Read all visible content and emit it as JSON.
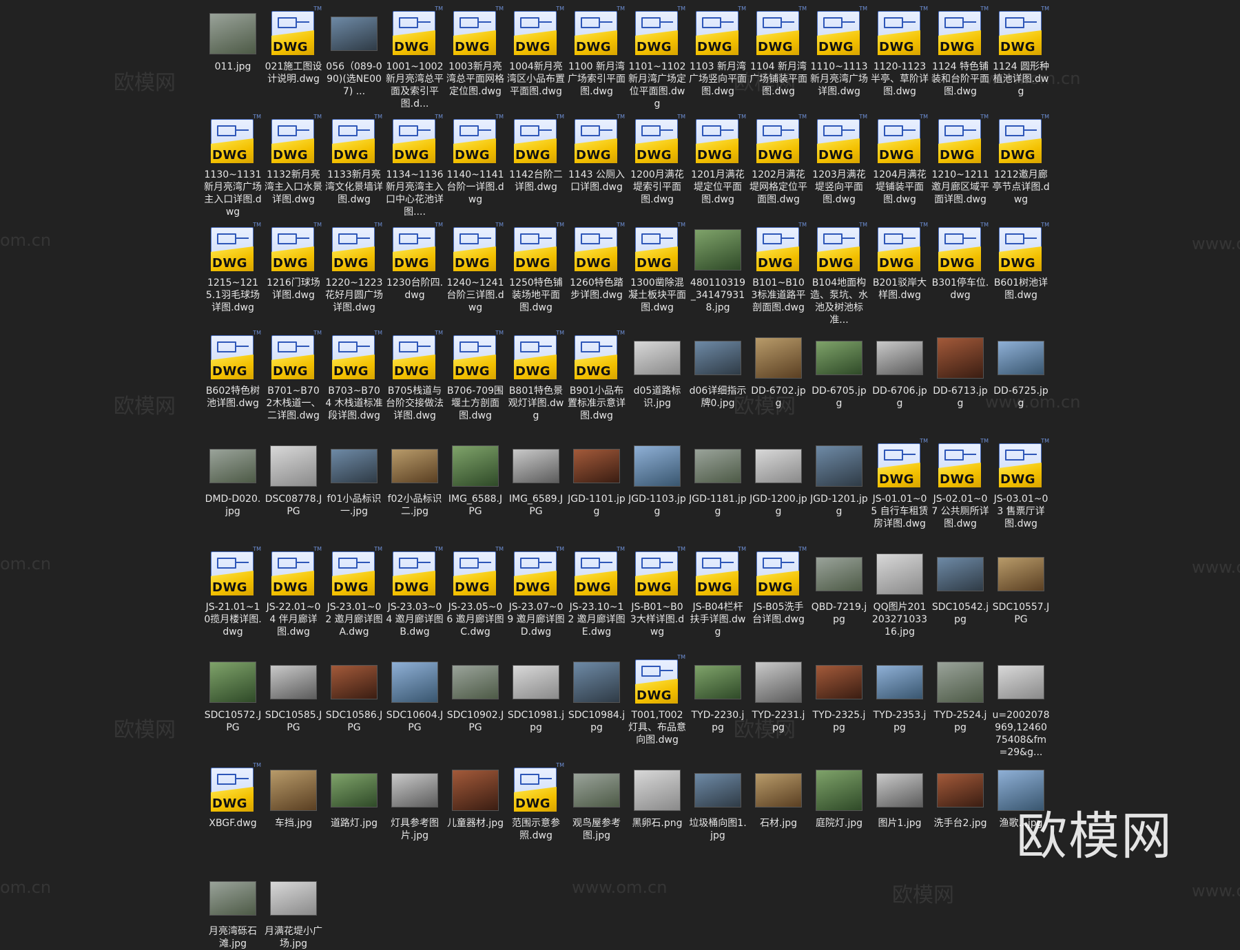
{
  "colors": {
    "background": "#222222",
    "label": "#e6e6e6"
  },
  "watermark": {
    "text_cn": "欧模网",
    "text_url": "www.om.cn",
    "text_partial": "om.cn",
    "corner": "欧模网"
  },
  "files": [
    {
      "name": "011.jpg",
      "kind": "img"
    },
    {
      "name": "021施工图设计说明.dwg",
      "kind": "dwg"
    },
    {
      "name": "056（089-090)(选NE007) ...",
      "kind": "img"
    },
    {
      "name": "1001~1002新月亮湾总平面及索引平图.d...",
      "kind": "dwg"
    },
    {
      "name": "1003新月亮湾总平面网格定位图.dwg",
      "kind": "dwg"
    },
    {
      "name": "1004新月亮湾区小品布置平面图.dwg",
      "kind": "dwg"
    },
    {
      "name": "1100 新月湾广场索引平面图.dwg",
      "kind": "dwg"
    },
    {
      "name": "1101~1102 新月湾广场定位平面图.dwg",
      "kind": "dwg"
    },
    {
      "name": "1103 新月湾广场竖向平面图.dwg",
      "kind": "dwg"
    },
    {
      "name": "1104 新月湾广场铺装平面图.dwg",
      "kind": "dwg"
    },
    {
      "name": "1110~1113新月亮湾广场详图.dwg",
      "kind": "dwg"
    },
    {
      "name": "1120-1123 半亭、草阶详图.dwg",
      "kind": "dwg"
    },
    {
      "name": "1124 特色铺装和台阶平面图.dwg",
      "kind": "dwg"
    },
    {
      "name": "1124 圆形种植池详图.dwg",
      "kind": "dwg"
    },
    {
      "name": "1130~1131新月亮湾广场主入口详图.dwg",
      "kind": "dwg"
    },
    {
      "name": "1132新月亮湾主入口水景详图.dwg",
      "kind": "dwg"
    },
    {
      "name": "1133新月亮湾文化景墙详图.dwg",
      "kind": "dwg"
    },
    {
      "name": "1134~1136新月亮湾主入口中心花池详图....",
      "kind": "dwg"
    },
    {
      "name": "1140~1141台阶一详图.dwg",
      "kind": "dwg"
    },
    {
      "name": "1142台阶二详图.dwg",
      "kind": "dwg"
    },
    {
      "name": "1143 公厕入口详图.dwg",
      "kind": "dwg"
    },
    {
      "name": "1200月满花堤索引平面图.dwg",
      "kind": "dwg"
    },
    {
      "name": "1201月满花堤定位平面图.dwg",
      "kind": "dwg"
    },
    {
      "name": "1202月满花堤网格定位平面图.dwg",
      "kind": "dwg"
    },
    {
      "name": "1203月满花堤竖向平面图.dwg",
      "kind": "dwg"
    },
    {
      "name": "1204月满花堤铺装平面图.dwg",
      "kind": "dwg"
    },
    {
      "name": "1210~1211邀月廊区域平面详图.dwg",
      "kind": "dwg"
    },
    {
      "name": "1212邀月廊亭节点详图.dwg",
      "kind": "dwg"
    },
    {
      "name": "1215~1215.1羽毛球场详图.dwg",
      "kind": "dwg"
    },
    {
      "name": "1216门球场详图.dwg",
      "kind": "dwg"
    },
    {
      "name": "1220~1223花好月圆广场详图.dwg",
      "kind": "dwg"
    },
    {
      "name": "1230台阶四.dwg",
      "kind": "dwg"
    },
    {
      "name": "1240~1241台阶三详图.dwg",
      "kind": "dwg"
    },
    {
      "name": "1250特色铺装场地平面图.dwg",
      "kind": "dwg"
    },
    {
      "name": "1260特色踏步详图.dwg",
      "kind": "dwg"
    },
    {
      "name": "1300凿除混凝土板块平面图.dwg",
      "kind": "dwg"
    },
    {
      "name": "480110319_341479318.jpg",
      "kind": "img"
    },
    {
      "name": "B101~B103标准道路平剖面图.dwg",
      "kind": "dwg"
    },
    {
      "name": "B104地面构造、泵坑、水池及树池标准...",
      "kind": "dwg"
    },
    {
      "name": "B201驳岸大样图.dwg",
      "kind": "dwg"
    },
    {
      "name": "B301停车位.dwg",
      "kind": "dwg"
    },
    {
      "name": "B601树池详图.dwg",
      "kind": "dwg"
    },
    {
      "name": "B602特色树池详图.dwg",
      "kind": "dwg"
    },
    {
      "name": "B701~B702木栈道一、二详图.dwg",
      "kind": "dwg"
    },
    {
      "name": "B703~B704 木栈道标准段详图.dwg",
      "kind": "dwg"
    },
    {
      "name": "B705栈道与台阶交接做法详图.dwg",
      "kind": "dwg"
    },
    {
      "name": "B706-709围堰土方剖面图.dwg",
      "kind": "dwg"
    },
    {
      "name": "B801特色景观灯详图.dwg",
      "kind": "dwg"
    },
    {
      "name": "B901小品布置标准示意详图.dwg",
      "kind": "dwg"
    },
    {
      "name": "d05道路标识.jpg",
      "kind": "img"
    },
    {
      "name": "d06详细指示牌0.jpg",
      "kind": "img"
    },
    {
      "name": "DD-6702.jpg",
      "kind": "img"
    },
    {
      "name": "DD-6705.jpg",
      "kind": "img"
    },
    {
      "name": "DD-6706.jpg",
      "kind": "img"
    },
    {
      "name": "DD-6713.jpg",
      "kind": "img"
    },
    {
      "name": "DD-6725.jpg",
      "kind": "img"
    },
    {
      "name": "DMD-D020.jpg",
      "kind": "img"
    },
    {
      "name": "DSC08778.JPG",
      "kind": "img"
    },
    {
      "name": "f01小品标识一.jpg",
      "kind": "img"
    },
    {
      "name": "f02小品标识二.jpg",
      "kind": "img"
    },
    {
      "name": "IMG_6588.JPG",
      "kind": "img"
    },
    {
      "name": "IMG_6589.JPG",
      "kind": "img"
    },
    {
      "name": "JGD-1101.jpg",
      "kind": "img"
    },
    {
      "name": "JGD-1103.jpg",
      "kind": "img"
    },
    {
      "name": "JGD-1181.jpg",
      "kind": "img"
    },
    {
      "name": "JGD-1200.jpg",
      "kind": "img"
    },
    {
      "name": "JGD-1201.jpg",
      "kind": "img"
    },
    {
      "name": "JS-01.01~05 自行车租赁房详图.dwg",
      "kind": "dwg"
    },
    {
      "name": "JS-02.01~07 公共厕所详图.dwg",
      "kind": "dwg"
    },
    {
      "name": "JS-03.01~03 售票厅详图.dwg",
      "kind": "dwg"
    },
    {
      "name": "JS-21.01~10揽月楼详图.dwg",
      "kind": "dwg"
    },
    {
      "name": "JS-22.01~04 伴月廊详图.dwg",
      "kind": "dwg"
    },
    {
      "name": "JS-23.01~02 邀月廊详图A.dwg",
      "kind": "dwg"
    },
    {
      "name": "JS-23.03~04 邀月廊详图B.dwg",
      "kind": "dwg"
    },
    {
      "name": "JS-23.05~06 邀月廊详图C.dwg",
      "kind": "dwg"
    },
    {
      "name": "JS-23.07~09 邀月廊详图D.dwg",
      "kind": "dwg"
    },
    {
      "name": "JS-23.10~12 邀月廊详图E.dwg",
      "kind": "dwg"
    },
    {
      "name": "JS-B01~B03大样详图.dwg",
      "kind": "dwg"
    },
    {
      "name": "JS-B04栏杆扶手详图.dwg",
      "kind": "dwg"
    },
    {
      "name": "JS-B05洗手台详图.dwg",
      "kind": "dwg"
    },
    {
      "name": "QBD-7219.jpg",
      "kind": "img"
    },
    {
      "name": "QQ图片20120327103316.jpg",
      "kind": "img"
    },
    {
      "name": "SDC10542.jpg",
      "kind": "img"
    },
    {
      "name": "SDC10557.JPG",
      "kind": "img"
    },
    {
      "name": "SDC10572.JPG",
      "kind": "img"
    },
    {
      "name": "SDC10585.JPG",
      "kind": "img"
    },
    {
      "name": "SDC10586.JPG",
      "kind": "img"
    },
    {
      "name": "SDC10604.JPG",
      "kind": "img"
    },
    {
      "name": "SDC10902.JPG",
      "kind": "img"
    },
    {
      "name": "SDC10981.jpg",
      "kind": "img"
    },
    {
      "name": "SDC10984.jpg",
      "kind": "img"
    },
    {
      "name": "T001,T002 灯具、布品意向图.dwg",
      "kind": "dwg"
    },
    {
      "name": "TYD-2230.jpg",
      "kind": "img"
    },
    {
      "name": "TYD-2231.jpg",
      "kind": "img"
    },
    {
      "name": "TYD-2325.jpg",
      "kind": "img"
    },
    {
      "name": "TYD-2353.jpg",
      "kind": "img"
    },
    {
      "name": "TYD-2524.jpg",
      "kind": "img"
    },
    {
      "name": "u=2002078969,1246075408&fm=29&g...",
      "kind": "img"
    },
    {
      "name": "XBGF.dwg",
      "kind": "dwg"
    },
    {
      "name": "车挡.jpg",
      "kind": "img"
    },
    {
      "name": "道路灯.jpg",
      "kind": "img"
    },
    {
      "name": "灯具参考图片.jpg",
      "kind": "img"
    },
    {
      "name": "儿童器材.jpg",
      "kind": "img"
    },
    {
      "name": "范围示意参照.dwg",
      "kind": "dwg"
    },
    {
      "name": "观鸟屋参考图.jpg",
      "kind": "img"
    },
    {
      "name": "黑卵石.png",
      "kind": "img"
    },
    {
      "name": "垃圾桶向图1.jpg",
      "kind": "img"
    },
    {
      "name": "石材.jpg",
      "kind": "img"
    },
    {
      "name": "庭院灯.jpg",
      "kind": "img"
    },
    {
      "name": "图片1.jpg",
      "kind": "img"
    },
    {
      "name": "洗手台2.jpg",
      "kind": "img"
    },
    {
      "name": "渔歌...jpg",
      "kind": "img"
    },
    {
      "name": "月亮湾砾石滩.jpg",
      "kind": "img"
    },
    {
      "name": "月满花堤小广场.jpg",
      "kind": "img"
    }
  ]
}
